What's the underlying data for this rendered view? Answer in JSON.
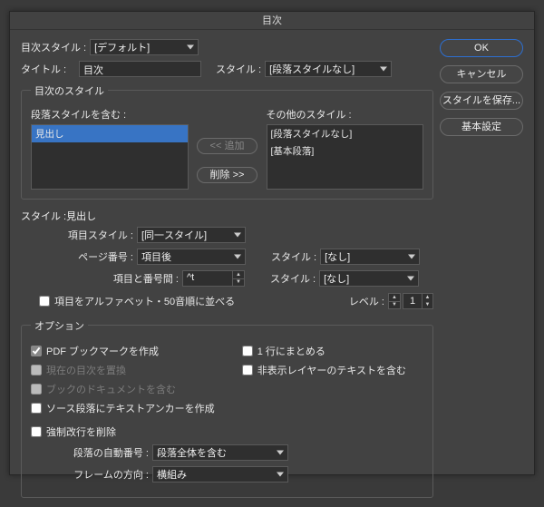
{
  "title": "目次",
  "buttons": {
    "ok": "OK",
    "cancel": "キャンセル",
    "save_style": "スタイルを保存...",
    "fewer_options": "基本設定"
  },
  "toc_style": {
    "label": "目次スタイル :",
    "value": "[デフォルト]"
  },
  "title_field": {
    "label": "タイトル :",
    "value": "目次",
    "style_label": "スタイル :",
    "style_value": "[段落スタイルなし]"
  },
  "styles_group": {
    "legend": "目次のスタイル",
    "include_label": "段落スタイルを含む :",
    "include_items": [
      "見出し"
    ],
    "other_label": "その他のスタイル :",
    "other_items": [
      "[段落スタイルなし]",
      "[基本段落]"
    ],
    "add": "<< 追加",
    "remove": "削除 >>"
  },
  "style_detail": {
    "head": "スタイル :見出し",
    "entry_style": {
      "label": "項目スタイル :",
      "value": "[同一スタイル]"
    },
    "page_num": {
      "label": "ページ番号 :",
      "value": "項目後",
      "style_label": "スタイル :",
      "style_value": "[なし]"
    },
    "between": {
      "label": "項目と番号間 :",
      "value": "^t",
      "style_label": "スタイル :",
      "style_value": "[なし]"
    },
    "sort": "項目をアルファベット・50音順に並べる",
    "level": {
      "label": "レベル :",
      "value": "1"
    }
  },
  "options": {
    "legend": "オプション",
    "pdf_bookmark": "PDF ブックマークを作成",
    "replace_toc": "現在の目次を置換",
    "include_book": "ブックのドキュメントを含む",
    "text_anchor": "ソース段落にテキストアンカーを作成",
    "run_in": "1 行にまとめる",
    "hidden_layers": "非表示レイヤーのテキストを含む",
    "remove_forced": "強制改行を削除",
    "auto_num": {
      "label": "段落の自動番号 :",
      "value": "段落全体を含む"
    },
    "frame_dir": {
      "label": "フレームの方向 :",
      "value": "横組み"
    }
  }
}
